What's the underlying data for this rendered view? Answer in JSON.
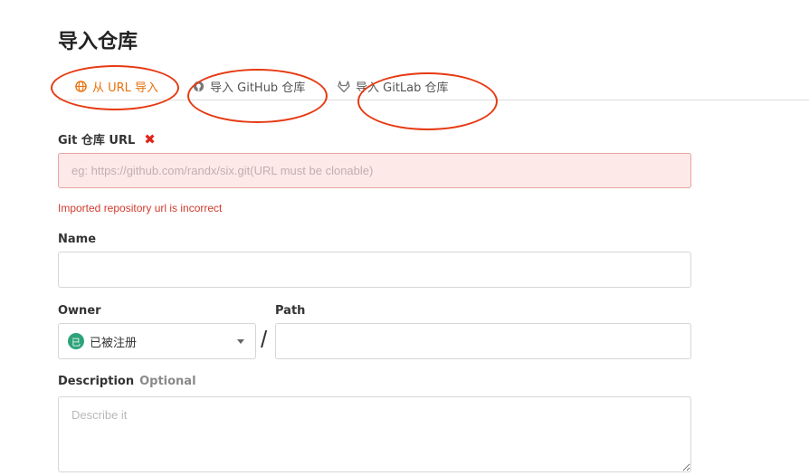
{
  "page": {
    "title": "导入仓库"
  },
  "tabs": [
    {
      "label": "从 URL 导入",
      "icon": "globe-icon",
      "active": true
    },
    {
      "label": "导入 GitHub 仓库",
      "icon": "github-icon",
      "active": false
    },
    {
      "label": "导入 GitLab 仓库",
      "icon": "gitlab-icon",
      "active": false
    }
  ],
  "form": {
    "git_url": {
      "label": "Git 仓库 URL",
      "required_mark": "✖",
      "placeholder": "eg: https://github.com/randx/six.git(URL must be clonable)",
      "error": "Imported repository url is incorrect"
    },
    "name": {
      "label": "Name",
      "value": ""
    },
    "owner": {
      "label": "Owner",
      "badge": "已",
      "selected": "已被注册"
    },
    "separator": "/",
    "path": {
      "label": "Path",
      "value": ""
    },
    "description": {
      "label": "Description",
      "optional": "Optional",
      "placeholder": "Describe it"
    }
  },
  "colors": {
    "accent": "#e8710a",
    "error": "#d23b2e",
    "annotation": "#e63a12",
    "badge": "#2ea37a"
  }
}
